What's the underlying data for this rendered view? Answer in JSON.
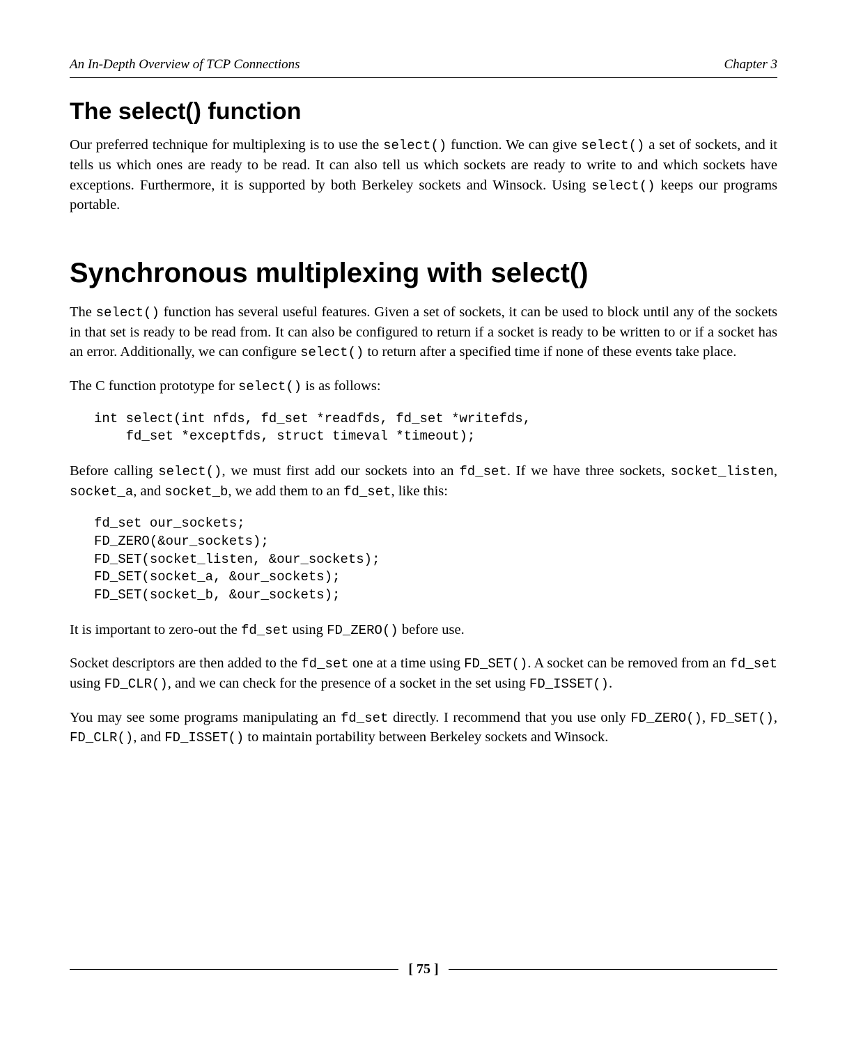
{
  "header": {
    "left": "An In-Depth Overview of TCP Connections",
    "right": "Chapter 3"
  },
  "section1": {
    "heading": "The select() function",
    "p1a": "Our preferred technique for multiplexing is to use the ",
    "p1code1": "select()",
    "p1b": " function. We can give ",
    "p1code2": "select()",
    "p1c": " a set of sockets, and it tells us which ones are ready to be read. It can also tell us which sockets are ready to write to and which sockets have exceptions. Furthermore, it is supported by both Berkeley sockets and Winsock. Using ",
    "p1code3": "select()",
    "p1d": " keeps our programs portable."
  },
  "section2": {
    "heading": "Synchronous multiplexing with select()",
    "p1a": "The ",
    "p1code1": "select()",
    "p1b": " function has several useful features. Given a set of sockets, it can be used to block until any of the sockets in that set is ready to be read from. It can also be configured to return if a socket is ready to be written to or if a socket has an error. Additionally, we can configure ",
    "p1code2": "select()",
    "p1c": " to return after a specified time if none of these events take place.",
    "p2a": "The C function prototype for ",
    "p2code1": "select()",
    "p2b": " is as follows:",
    "code1": "int select(int nfds, fd_set *readfds, fd_set *writefds,\n    fd_set *exceptfds, struct timeval *timeout);",
    "p3a": "Before calling ",
    "p3code1": "select()",
    "p3b": ", we must first add our sockets into an ",
    "p3code2": "fd_set",
    "p3c": ". If we have three sockets, ",
    "p3code3": "socket_listen",
    "p3d": ", ",
    "p3code4": "socket_a",
    "p3e": ", and ",
    "p3code5": "socket_b",
    "p3f": ", we add them to an ",
    "p3code6": "fd_set",
    "p3g": ", like this:",
    "code2": "fd_set our_sockets;\nFD_ZERO(&our_sockets);\nFD_SET(socket_listen, &our_sockets);\nFD_SET(socket_a, &our_sockets);\nFD_SET(socket_b, &our_sockets);",
    "p4a": "It is important to zero-out the ",
    "p4code1": "fd_set",
    "p4b": " using ",
    "p4code2": "FD_ZERO()",
    "p4c": " before use.",
    "p5a": "Socket descriptors are then added to the ",
    "p5code1": "fd_set",
    "p5b": " one at a time using ",
    "p5code2": "FD_SET()",
    "p5c": ". A socket can be removed from an ",
    "p5code3": "fd_set",
    "p5d": " using ",
    "p5code4": "FD_CLR()",
    "p5e": ", and we can check for the presence of a socket in the set using ",
    "p5code5": "FD_ISSET()",
    "p5f": ".",
    "p6a": "You may see some programs manipulating an ",
    "p6code1": "fd_set",
    "p6b": " directly. I recommend that you use only ",
    "p6code2": "FD_ZERO()",
    "p6c": ", ",
    "p6code3": "FD_SET()",
    "p6d": ", ",
    "p6code4": "FD_CLR()",
    "p6e": ", and ",
    "p6code5": "FD_ISSET()",
    "p6f": " to maintain portability between Berkeley sockets and Winsock."
  },
  "footer": {
    "page": "[ 75 ]"
  }
}
